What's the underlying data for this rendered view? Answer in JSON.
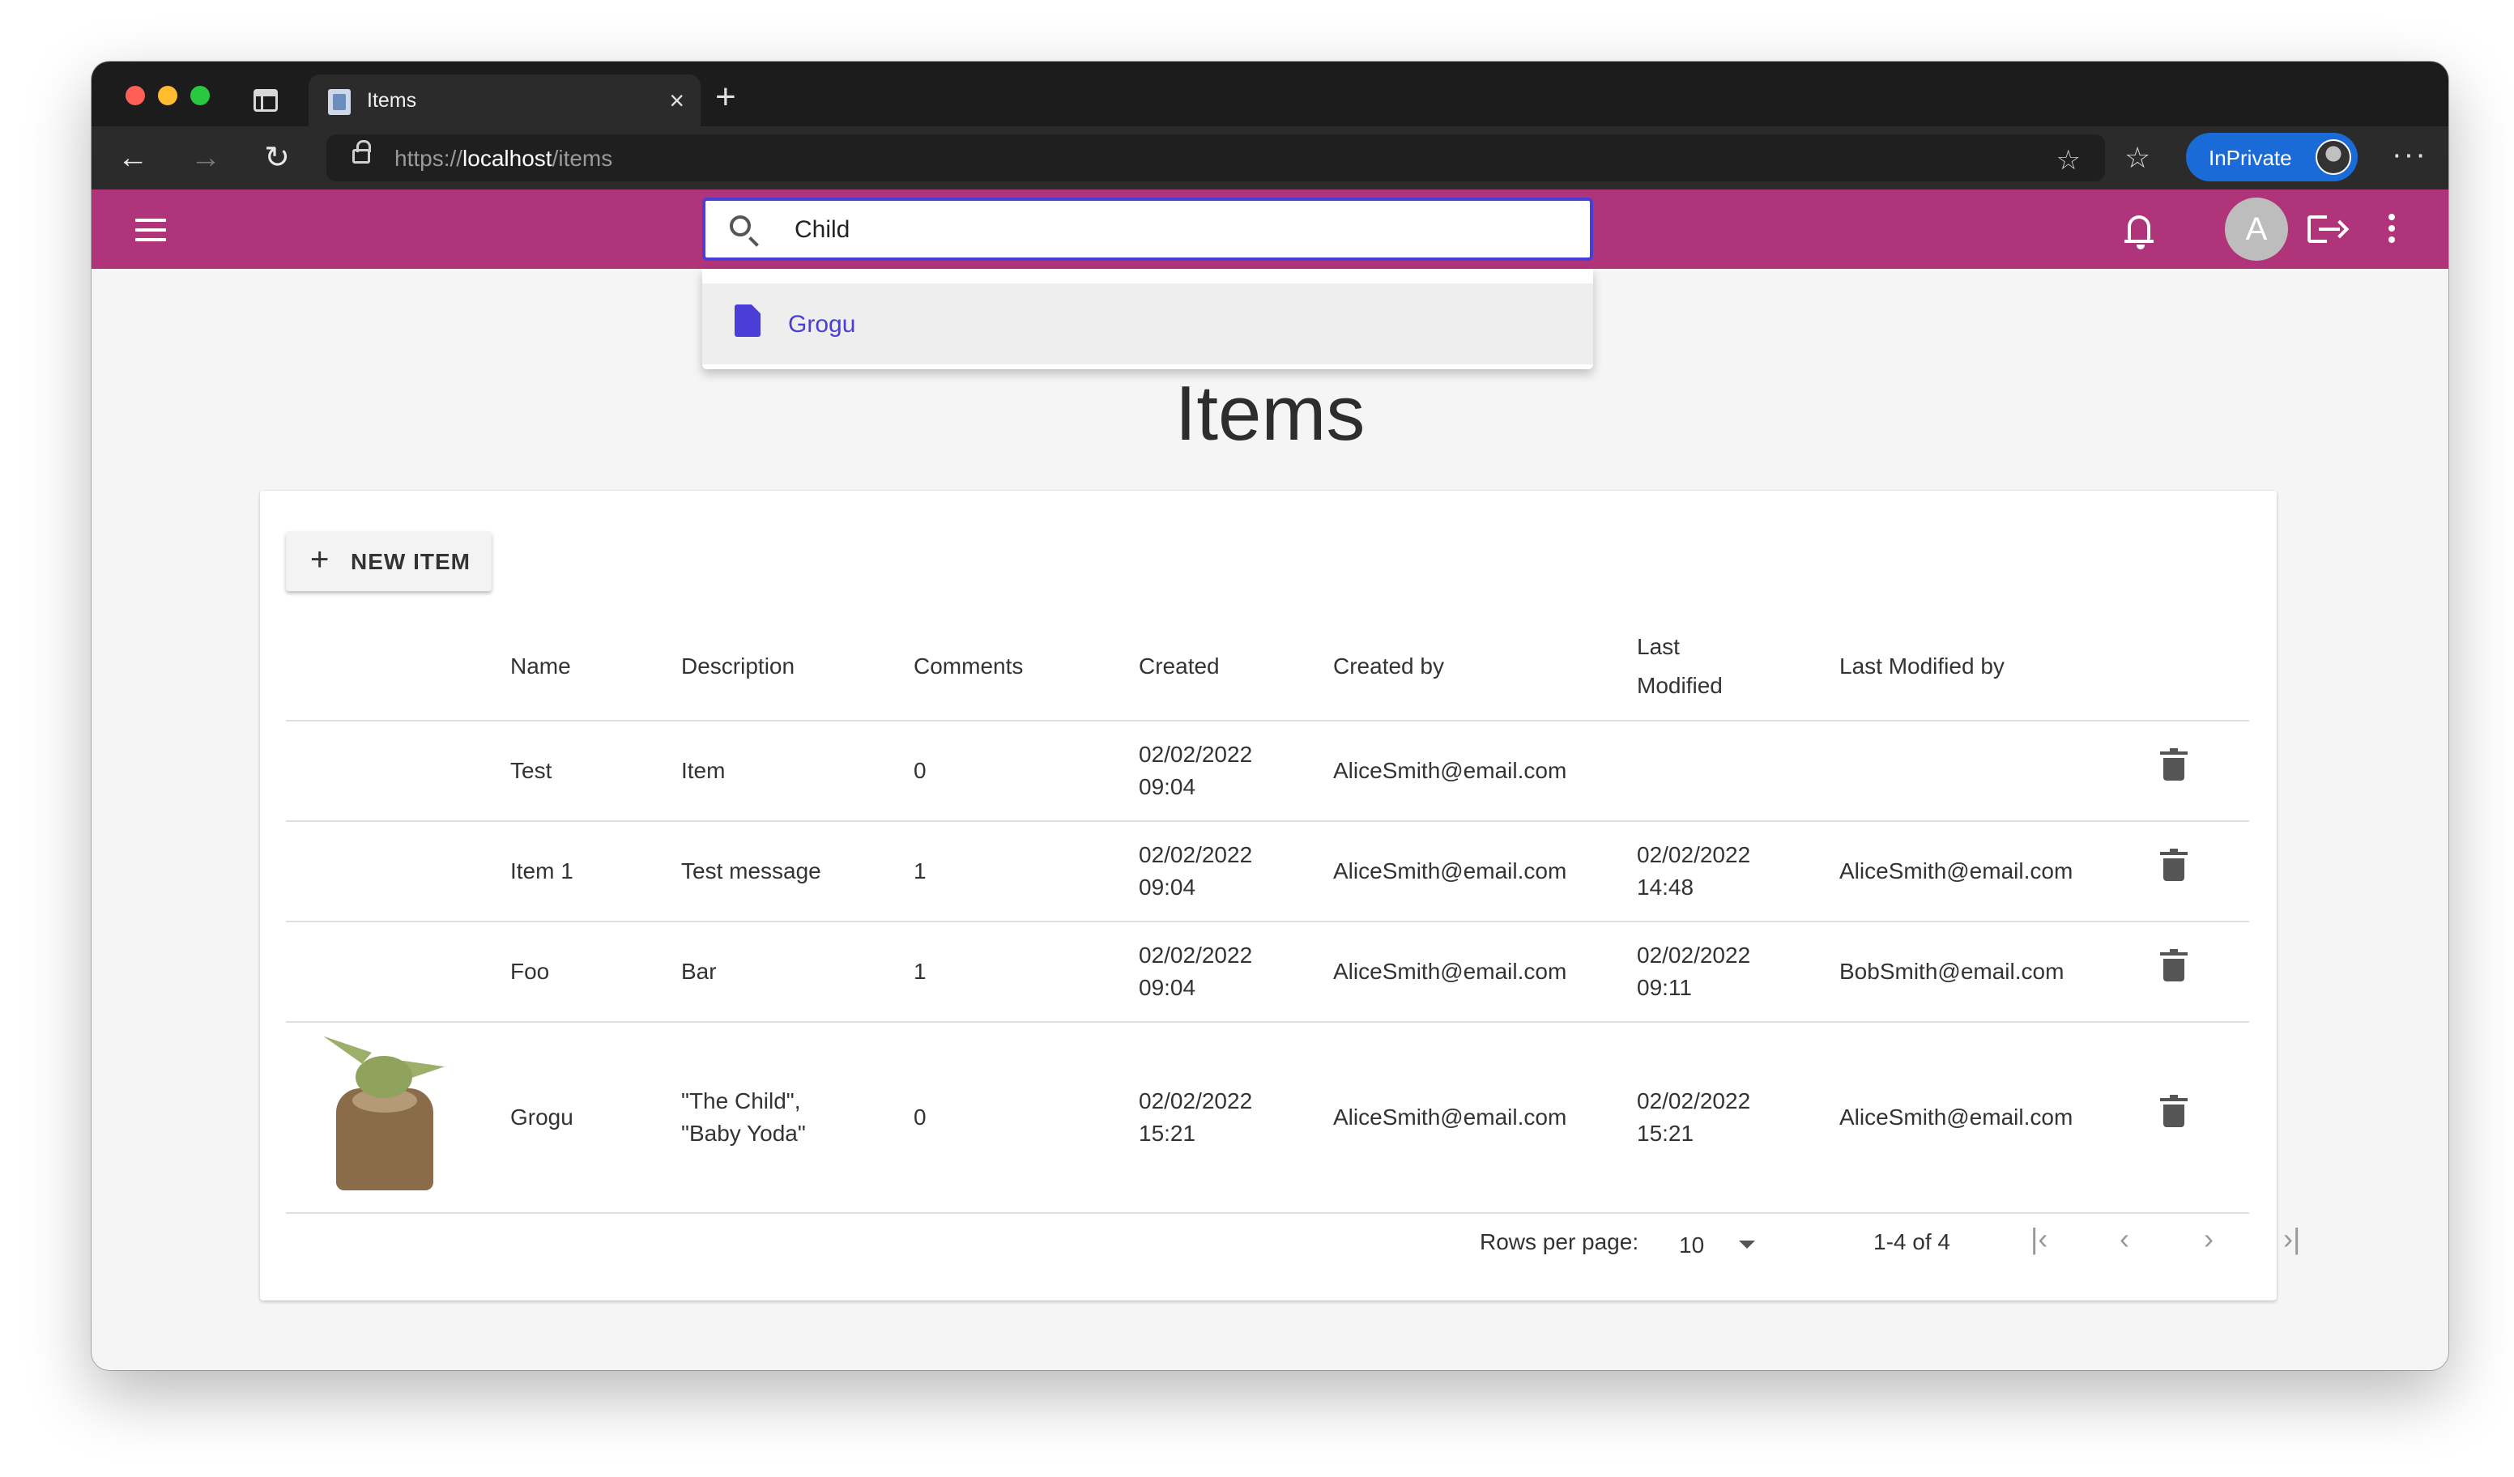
{
  "browser": {
    "tab_title": "Items",
    "tab_close": "×",
    "new_tab": "+",
    "url_scheme": "https://",
    "url_host": "localhost",
    "url_path": "/items",
    "inprivate_label": "InPrivate",
    "more_menu": "···"
  },
  "appbar": {
    "color": "#b0347a",
    "search_value": "Child",
    "avatar_initial": "A"
  },
  "search_results": [
    {
      "label": "Grogu",
      "icon": "document-icon"
    }
  ],
  "page": {
    "title": "Items",
    "new_item_label": "NEW ITEM"
  },
  "table": {
    "headers": {
      "name": "Name",
      "description": "Description",
      "comments": "Comments",
      "created": "Created",
      "created_by": "Created by",
      "last_modified_1": "Last",
      "last_modified_2": "Modified",
      "last_modified_by": "Last Modified by"
    },
    "rows": [
      {
        "name": "Test",
        "description_1": "Item",
        "description_2": "",
        "comments": "0",
        "created_date": "02/02/2022",
        "created_time": "09:04",
        "created_by": "AliceSmith@email.com",
        "modified_date": "",
        "modified_time": "",
        "modified_by": ""
      },
      {
        "name": "Item 1",
        "description_1": "Test message",
        "description_2": "",
        "comments": "1",
        "created_date": "02/02/2022",
        "created_time": "09:04",
        "created_by": "AliceSmith@email.com",
        "modified_date": "02/02/2022",
        "modified_time": "14:48",
        "modified_by": "AliceSmith@email.com"
      },
      {
        "name": "Foo",
        "description_1": "Bar",
        "description_2": "",
        "comments": "1",
        "created_date": "02/02/2022",
        "created_time": "09:04",
        "created_by": "AliceSmith@email.com",
        "modified_date": "02/02/2022",
        "modified_time": "09:11",
        "modified_by": "BobSmith@email.com"
      },
      {
        "name": "Grogu",
        "description_1": "\"The Child\",",
        "description_2": "\"Baby Yoda\"",
        "comments": "0",
        "created_date": "02/02/2022",
        "created_time": "15:21",
        "created_by": "AliceSmith@email.com",
        "modified_date": "02/02/2022",
        "modified_time": "15:21",
        "modified_by": "AliceSmith@email.com"
      }
    ]
  },
  "pagination": {
    "rows_per_page_label": "Rows per page:",
    "rows_per_page_value": "10",
    "range": "1-4 of 4",
    "first": "|‹",
    "prev": "‹",
    "next": "›",
    "last": "›|"
  }
}
